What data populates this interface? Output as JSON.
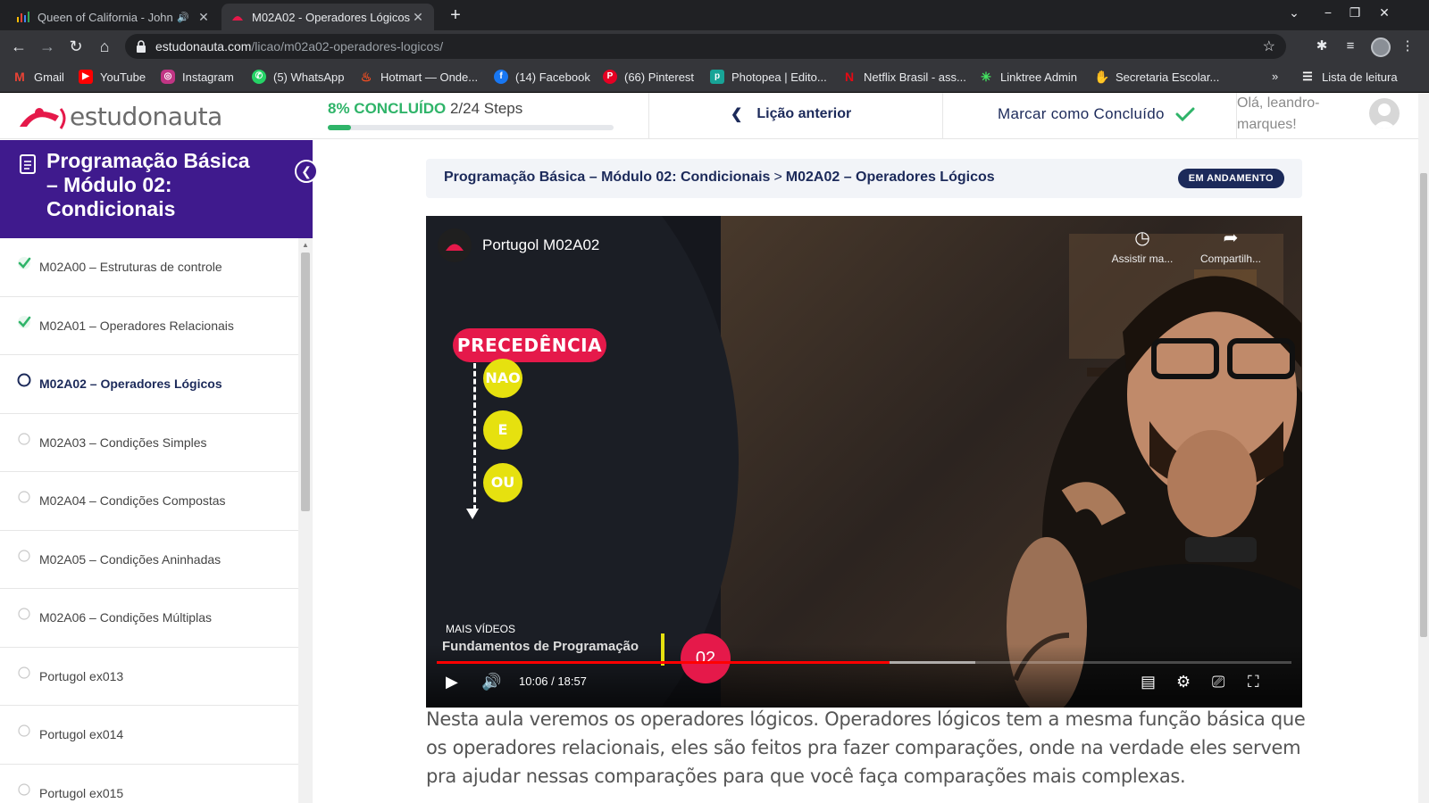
{
  "browser": {
    "tabs": [
      {
        "title": "Queen of California - John",
        "active": false
      },
      {
        "title": "M02A02 - Operadores Lógicos",
        "active": true
      }
    ],
    "url_domain": "estudonauta.com",
    "url_path": "/licao/m02a02-operadores-logicos/",
    "bookmarks": [
      {
        "label": "Gmail",
        "icon": "gmail-icon",
        "color": "#ea4335"
      },
      {
        "label": "YouTube",
        "icon": "youtube-icon",
        "color": "#ff0000"
      },
      {
        "label": "Instagram",
        "icon": "instagram-icon",
        "color": "#c13584"
      },
      {
        "label": "(5) WhatsApp",
        "icon": "whatsapp-icon",
        "color": "#25d366"
      },
      {
        "label": "Hotmart — Onde...",
        "icon": "hotmart-icon",
        "color": "#f04e23"
      },
      {
        "label": "(14) Facebook",
        "icon": "facebook-icon",
        "color": "#1877f2"
      },
      {
        "label": "(66) Pinterest",
        "icon": "pinterest-icon",
        "color": "#e60023"
      },
      {
        "label": "Photopea | Edito...",
        "icon": "photopea-icon",
        "color": "#18a497"
      },
      {
        "label": "Netflix Brasil - ass...",
        "icon": "netflix-icon",
        "color": "#e50914"
      },
      {
        "label": "Linktree Admin",
        "icon": "linktree-icon",
        "color": "#43e660"
      },
      {
        "label": "Secretaria Escolar...",
        "icon": "secretaria-icon",
        "color": "#4a90d9"
      }
    ],
    "reading_list": "Lista de leitura"
  },
  "header": {
    "logo_text": "estudonauta",
    "progress_percent_label": "8% CONCLUÍDO",
    "progress_steps": "2/24 Steps",
    "progress_fraction": 0.08,
    "prev_lesson": "Lição anterior",
    "mark_complete": "Marcar como Concluído",
    "greeting": "Olá, leandro-marques!"
  },
  "sidebar": {
    "course_title": "Programação Básica – Módulo 02: Condicionais",
    "lessons": [
      {
        "label": "M02A00 – Estruturas de controle",
        "status": "done"
      },
      {
        "label": "M02A01 – Operadores Relacionais",
        "status": "done"
      },
      {
        "label": "M02A02 – Operadores Lógicos",
        "status": "current"
      },
      {
        "label": "M02A03 – Condições Simples",
        "status": "todo"
      },
      {
        "label": "M02A04 – Condições Compostas",
        "status": "todo"
      },
      {
        "label": "M02A05 – Condições Aninhadas",
        "status": "todo"
      },
      {
        "label": "M02A06 – Condições Múltiplas",
        "status": "todo"
      },
      {
        "label": "Portugol ex013",
        "status": "todo"
      },
      {
        "label": "Portugol ex014",
        "status": "todo"
      },
      {
        "label": "Portugol ex015",
        "status": "todo"
      }
    ]
  },
  "main": {
    "breadcrumb": {
      "course": "Programação Básica – Módulo 02: Condicionais",
      "separator": ">",
      "lesson": "M02A02 – Operadores Lógicos"
    },
    "status_badge": "EM ANDAMENTO",
    "video": {
      "title": "Portugol M02A02",
      "watch_later": "Assistir ma...",
      "share": "Compartilh...",
      "precedence_label": "PRECEDÊNCIA",
      "operators": [
        "NAO",
        "E",
        "OU"
      ],
      "more_videos": "MAIS VÍDEOS",
      "watermark": "Fundamentos de Programação",
      "module_badge": "02",
      "time": "10:06 / 18:57",
      "played_fraction": 0.53,
      "buffered_fraction": 0.63
    },
    "description": "Nesta aula veremos os operadores lógicos. Operadores lógicos tem a mesma função básica que os operadores relacionais, eles são feitos pra fazer comparações, onde na verdade eles servem pra ajudar nessas comparações para que você faça comparações mais complexas."
  },
  "colors": {
    "brand_purple": "#3f1a8d",
    "navy": "#1c2a5a",
    "success_green": "#2fb469",
    "accent_red": "#e5194a",
    "operator_yellow": "#e6e10f"
  }
}
